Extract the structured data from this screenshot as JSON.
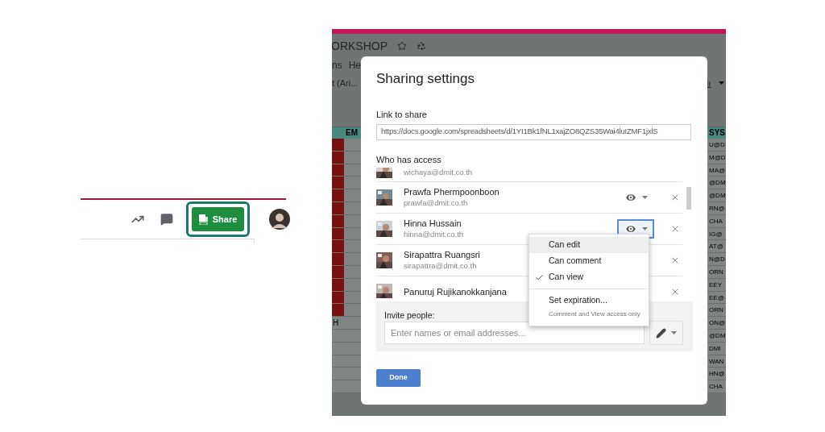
{
  "toolbar": {
    "share_button": "Share"
  },
  "background_sheet": {
    "title": "ORKSHOP",
    "menu_items": [
      "ns",
      "He"
    ],
    "font_selector": "t (Ari...",
    "columns": [
      "EM",
      "SYS"
    ],
    "left_cell": "H",
    "right_cells": [
      "U@D",
      "M@D",
      "MA@",
      "@DM",
      "@DM",
      "RN@",
      "CHA",
      "IG@",
      "AT@",
      "N@D",
      "ORN",
      "EEY",
      "EE@",
      "ORN",
      "ON@",
      "@DM",
      "DMI",
      "WAN",
      "HN@",
      "CHA"
    ]
  },
  "dialog": {
    "title": "Sharing settings",
    "link_label": "Link to share",
    "link": "https://docs.google.com/spreadsheets/d/1YI1Bk1fNL1xajZO8QZS35Wai4luIZMF1jxlS",
    "access_label": "Who has access",
    "people": [
      {
        "email": "wichaya@dmit.co.th"
      },
      {
        "name": "Prawfa Phermpoonboon",
        "email": "prawfa@dmit.co.th",
        "open": false
      },
      {
        "name": "Hinna Hussain",
        "email": "hinna@dmit.co.th",
        "open": true
      },
      {
        "name": "Sirapattra Ruangsri",
        "email": "sirapattra@dmit.co.th"
      },
      {
        "name": "Panuruj Rujikanokkanjana"
      }
    ],
    "permissions": [
      {
        "label": "Can edit",
        "checked": false,
        "highlighted": true
      },
      {
        "label": "Can comment",
        "checked": false,
        "highlighted": false
      },
      {
        "label": "Can view",
        "checked": true,
        "highlighted": false
      }
    ],
    "expiration": {
      "label": "Set expiration...",
      "note": "Comment and View access only"
    },
    "invite": {
      "label": "Invite people:",
      "placeholder": "Enter names or email addresses..."
    },
    "done_button": "Done"
  }
}
